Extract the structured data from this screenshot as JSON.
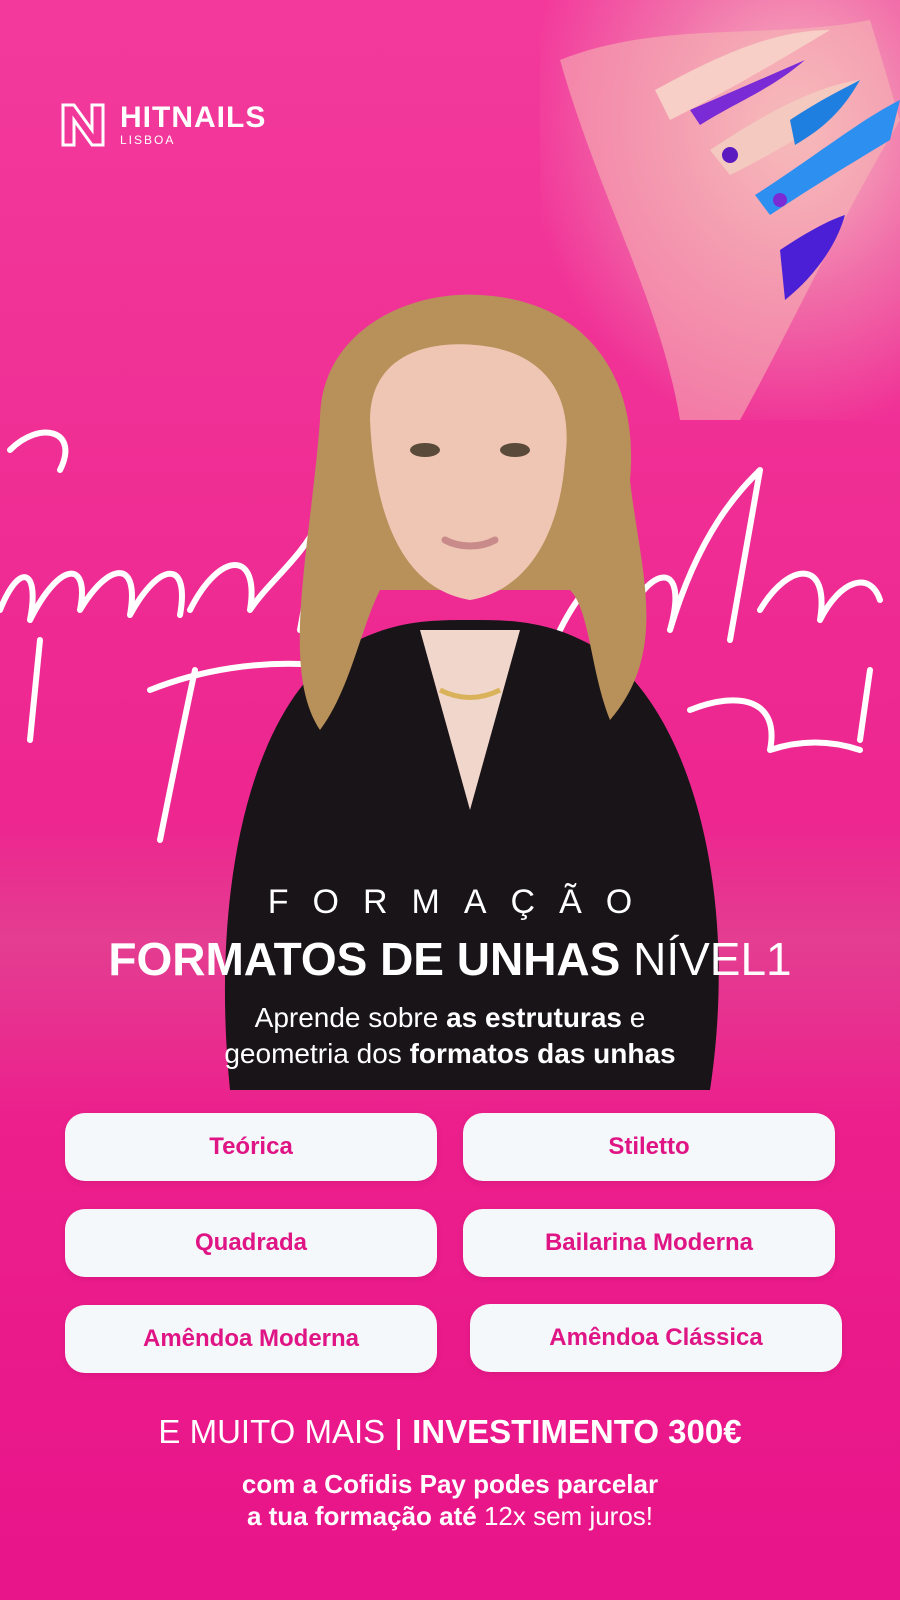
{
  "brand": {
    "name": "HITNAILS",
    "location": "LISBOA"
  },
  "script_overlay": "Formatos de unhas Nível 1",
  "hero": {
    "eyebrow": "FORMAÇÃO",
    "title_bold": "FORMATOS DE UNHAS",
    "title_level": "NÍVEL1"
  },
  "subtitle": {
    "line1_pre": "Aprende sobre ",
    "line1_bold": "as estruturas",
    "line1_post": " e",
    "line2_pre": "geometria dos ",
    "line2_bold": "formatos das unhas"
  },
  "topics": [
    "Teórica",
    "Stiletto",
    "Quadrada",
    "Bailarina Moderna",
    "Amêndoa Moderna",
    "Amêndoa Clássica"
  ],
  "footer": {
    "more": "E MUITO MAIS | ",
    "investment": "INVESTIMENTO 300€",
    "pay_line1": "com a Cofidis Pay podes parcelar",
    "pay_line2_bold": "a tua formação até ",
    "pay_line2_light": "12x sem juros!"
  },
  "colors": {
    "background": "#ec1f8c",
    "chip_background": "#f4f8fb",
    "chip_text": "#e01585",
    "text": "#ffffff"
  },
  "icons": [
    "hitnails-logo-icon"
  ]
}
